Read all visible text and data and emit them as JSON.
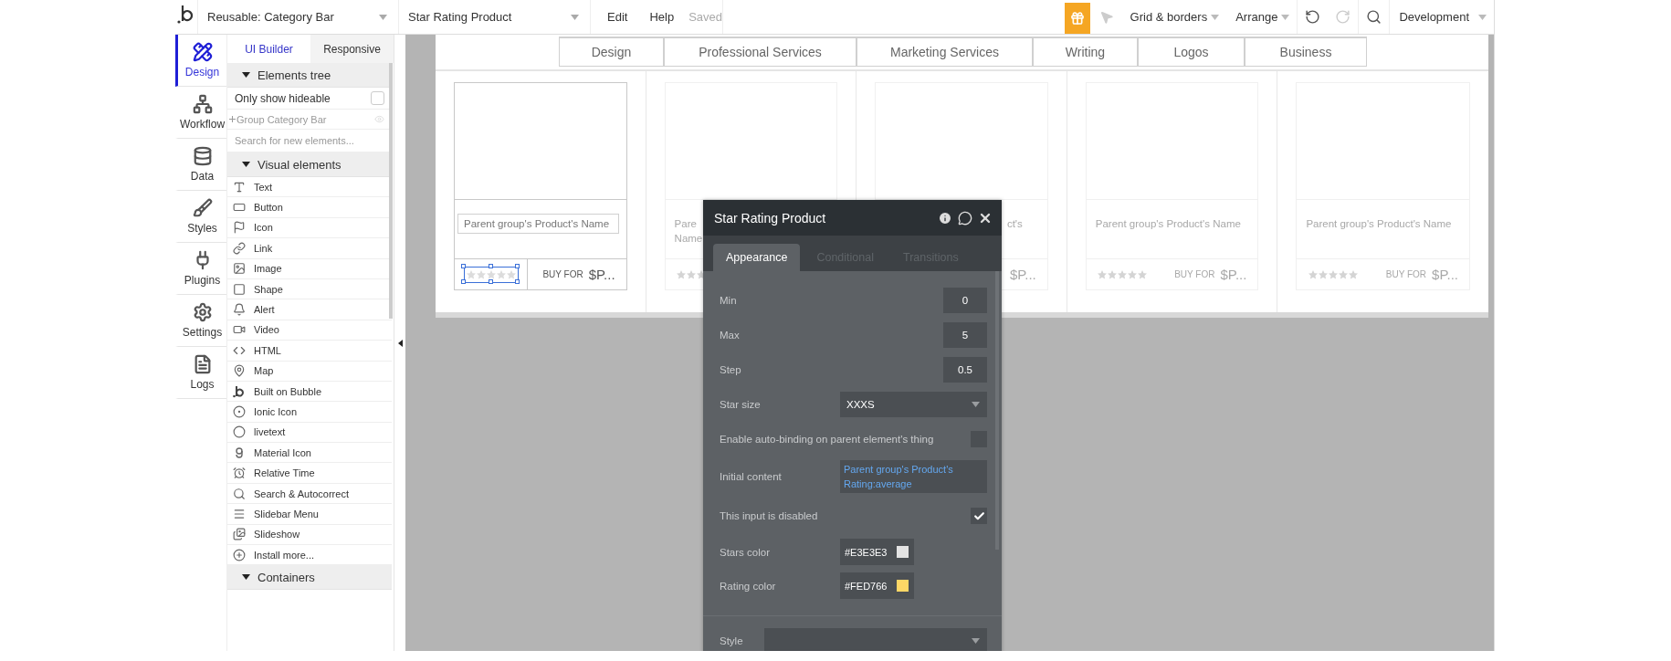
{
  "topbar": {
    "page_select": "Reusable: Category Bar",
    "element_select": "Star Rating Product",
    "menu": [
      "Edit",
      "Help"
    ],
    "status": "Saved",
    "grid_menu": "Grid & borders",
    "arrange_menu": "Arrange",
    "version_select": "Development"
  },
  "sidebar": {
    "tabs": [
      {
        "label": "Design",
        "selected": true
      },
      {
        "label": "Workflow",
        "selected": false
      },
      {
        "label": "Data",
        "selected": false
      },
      {
        "label": "Styles",
        "selected": false
      },
      {
        "label": "Plugins",
        "selected": false
      },
      {
        "label": "Settings",
        "selected": false
      },
      {
        "label": "Logs",
        "selected": false
      }
    ]
  },
  "panel": {
    "tabs": [
      {
        "label": "UI Builder",
        "selected": true
      },
      {
        "label": "Responsive",
        "selected": false
      }
    ],
    "elements_tree": {
      "title": "Elements tree",
      "expanded": true,
      "only_hideable": {
        "label": "Only show hideable",
        "checked": false
      },
      "items": [
        {
          "label": "Group Category Bar"
        }
      ],
      "search": {
        "placeholder": "Search for new elements..."
      }
    },
    "sections": [
      {
        "title": "Visual elements",
        "expanded": true,
        "items": [
          {
            "label": "Text"
          },
          {
            "label": "Button"
          },
          {
            "label": "Icon"
          },
          {
            "label": "Link"
          },
          {
            "label": "Image"
          },
          {
            "label": "Shape"
          },
          {
            "label": "Alert"
          },
          {
            "label": "Video"
          },
          {
            "label": "HTML"
          },
          {
            "label": "Map"
          },
          {
            "label": "Built on Bubble"
          },
          {
            "label": "Ionic Icon"
          },
          {
            "label": "livetext"
          },
          {
            "label": "Material Icon"
          },
          {
            "label": "Relative Time"
          },
          {
            "label": "Search & Autocorrect"
          },
          {
            "label": "Slidebar Menu"
          },
          {
            "label": "Slideshow"
          },
          {
            "label": "Install more..."
          }
        ]
      },
      {
        "title": "Containers",
        "expanded": true
      }
    ]
  },
  "canvas": {
    "categories": [
      "Design",
      "Professional Services",
      "Marketing Services",
      "Writing",
      "Logos",
      "Business"
    ],
    "cards": [
      {
        "name_lines": [
          {
            "text": "Parent group's Product's Name",
            "kind": "whole"
          }
        ],
        "buy_label": "BUY FOR",
        "price": "$P...",
        "stars": 0,
        "selected": true
      },
      {
        "name_lines": [
          {
            "text": "Pare",
            "kind": "head"
          },
          {
            "text": "Name",
            "kind": "head"
          }
        ],
        "stars": 0,
        "selected": false
      },
      {
        "name_lines": [
          {
            "text": "ct's",
            "kind": "tail"
          }
        ],
        "price": "$P...",
        "selected": false
      },
      {
        "name_lines": [
          {
            "text": "Parent group's Product's Name",
            "kind": "whole"
          }
        ],
        "buy_label": "BUY FOR",
        "price": "$P...",
        "stars": 0,
        "selected": false
      },
      {
        "name_lines": [
          {
            "text": "Parent group's Product's Name",
            "kind": "whole"
          }
        ],
        "buy_label": "BUY FOR",
        "price": "$P...",
        "stars": 0,
        "selected": false
      }
    ]
  },
  "property_editor": {
    "title": "Star Rating Product",
    "tabs": [
      {
        "label": "Appearance",
        "selected": true
      },
      {
        "label": "Conditional",
        "selected": false
      },
      {
        "label": "Transitions",
        "selected": false
      }
    ],
    "fields": [
      {
        "kind": "number",
        "label": "Min",
        "value": "0"
      },
      {
        "kind": "number",
        "label": "Max",
        "value": "5"
      },
      {
        "kind": "number",
        "label": "Step",
        "value": "0.5"
      },
      {
        "kind": "dropdown",
        "label": "Star size",
        "value": "XXXS"
      },
      {
        "kind": "checkbox",
        "label": "Enable auto-binding on parent element's thing",
        "checked": false
      },
      {
        "kind": "expression",
        "label": "Initial content",
        "value": "Parent group's Product's Rating:average"
      },
      {
        "kind": "checkbox",
        "label": "This input is disabled",
        "checked": true
      },
      {
        "kind": "color",
        "label": "Stars color",
        "value": "#E3E3E3",
        "color": "#e3e3e3"
      },
      {
        "kind": "color",
        "label": "Rating color",
        "value": "#FED766",
        "color": "#fed766"
      }
    ],
    "style": {
      "label": "Style"
    }
  }
}
